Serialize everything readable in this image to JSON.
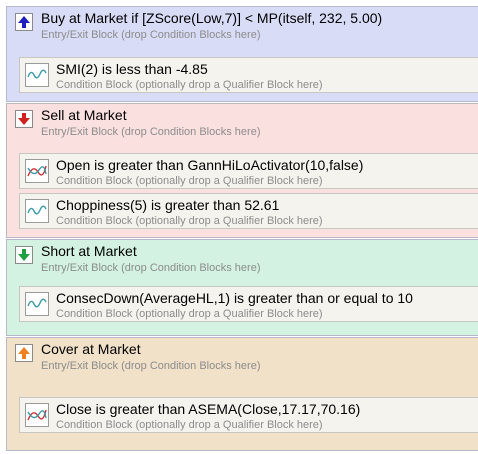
{
  "blocks": [
    {
      "title": "Buy at Market if [ZScore(Low,7)] < MP(itself, 232, 5.00)",
      "subtitle": "Entry/Exit Block (drop Condition Blocks here)",
      "color": "#d9dcf6",
      "icon": "arrow-up-icon",
      "icon_color": "#2020c0",
      "conditions": [
        {
          "title": "SMI(2) is less than -4.85",
          "subtitle": "Condition Block (optionally drop a Qualifier Block here)",
          "icon": "wave-icon",
          "icon_color": "#3a9aa8"
        }
      ]
    },
    {
      "title": "Sell at Market",
      "subtitle": "Entry/Exit Block (drop Condition Blocks here)",
      "color": "#fbe0e0",
      "icon": "arrow-down-icon",
      "icon_color": "#d02020",
      "conditions": [
        {
          "title": "Open is greater than GannHiLoActivator(10,false)",
          "subtitle": "Condition Block (optionally drop a Qualifier Block here)",
          "icon": "crossing-lines-icon",
          "icon_color": "#d03030"
        },
        {
          "title": "Choppiness(5) is greater than 52.61",
          "subtitle": "Condition Block (optionally drop a Qualifier Block here)",
          "icon": "wave-icon",
          "icon_color": "#3a9aa8"
        }
      ]
    },
    {
      "title": "Short at Market",
      "subtitle": "Entry/Exit Block (drop Condition Blocks here)",
      "color": "#d3f2e1",
      "icon": "arrow-down-icon",
      "icon_color": "#20a040",
      "conditions": [
        {
          "title": "ConsecDown(AverageHL,1) is greater than or equal to 10",
          "subtitle": "Condition Block (optionally drop a Qualifier Block here)",
          "icon": "wave-icon",
          "icon_color": "#3a9aa8"
        }
      ]
    },
    {
      "title": "Cover at Market",
      "subtitle": "Entry/Exit Block (drop Condition Blocks here)",
      "color": "#f1e1c8",
      "icon": "arrow-up-icon",
      "icon_color": "#f08020",
      "conditions": [
        {
          "title": "Close is greater than ASEMA(Close,17.17,70.16)",
          "subtitle": "Condition Block (optionally drop a Qualifier Block here)",
          "icon": "crossing-lines-icon",
          "icon_color": "#d03030"
        }
      ]
    }
  ]
}
